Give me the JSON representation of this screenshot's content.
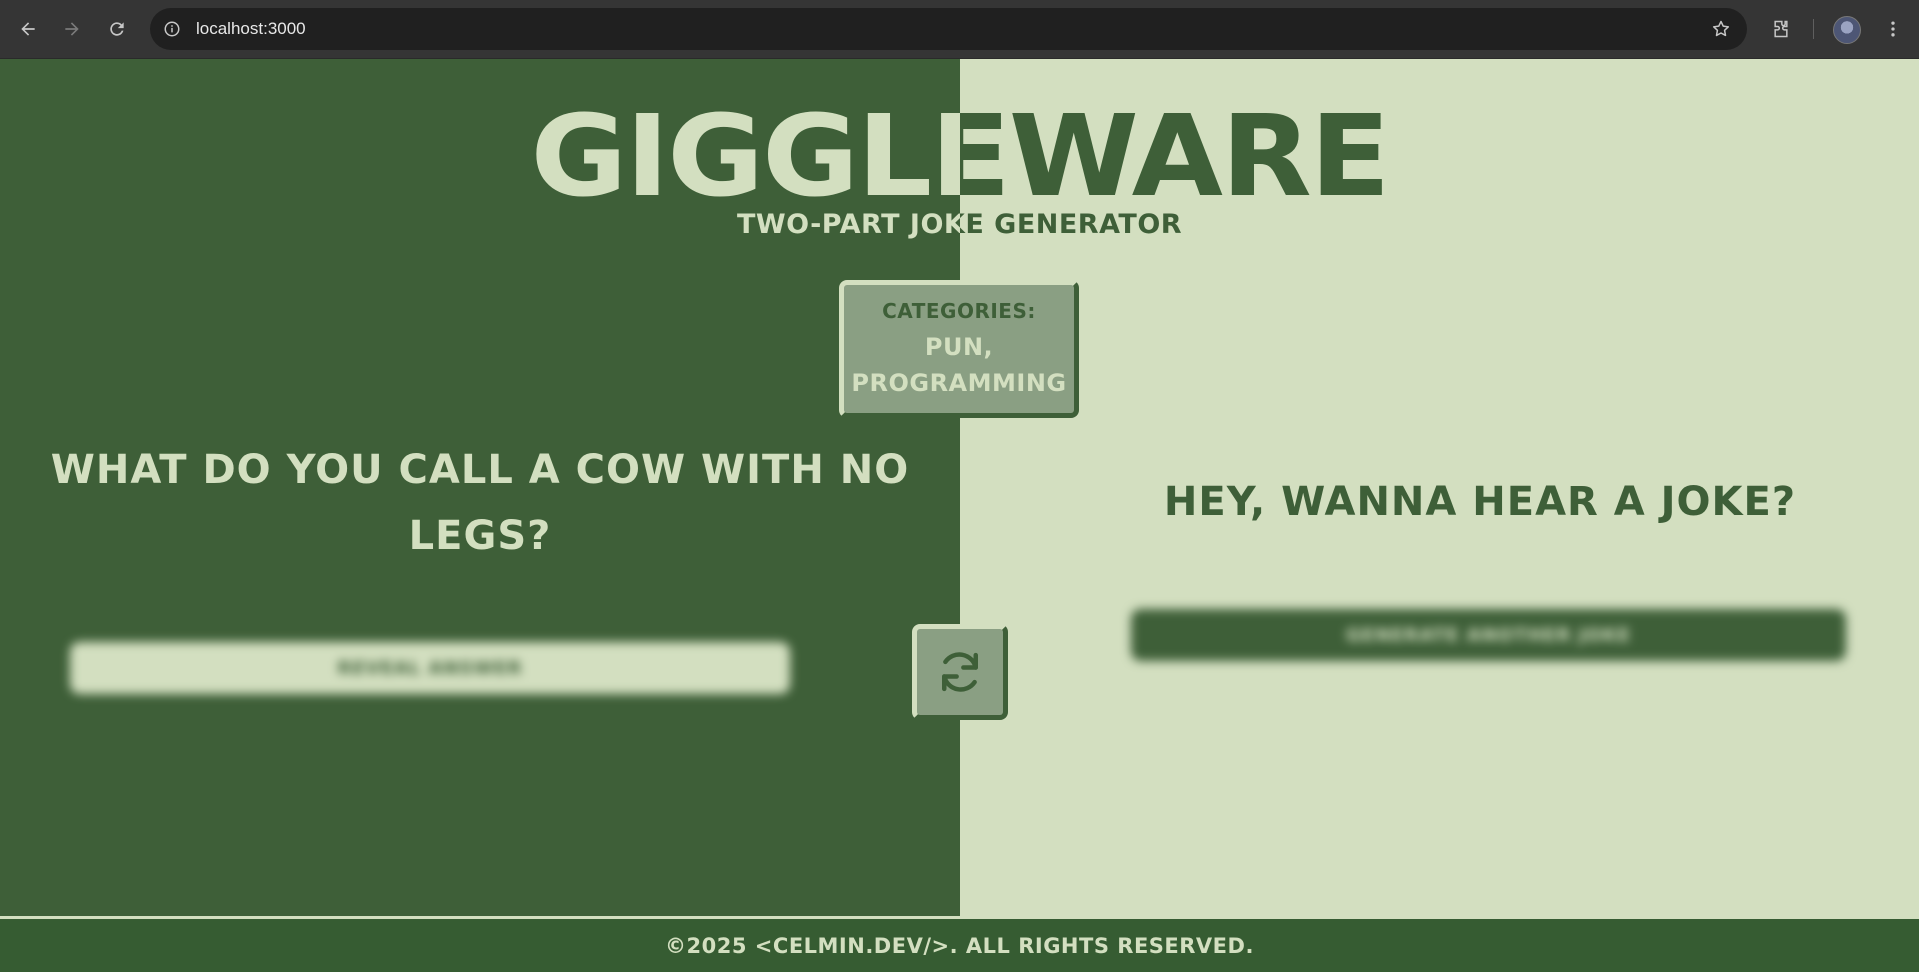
{
  "browser": {
    "url": "localhost:3000"
  },
  "header": {
    "logo": "GIGGLEWARE",
    "subtitle": "TWO-PART JOKE GENERATOR"
  },
  "categories": {
    "label": "CATEGORIES:",
    "values_line1": "PUN,",
    "values_line2": "PROGRAMMING"
  },
  "joke": {
    "question": "WHAT DO YOU CALL A COW WITH NO LEGS?",
    "setup_prompt": "HEY, WANNA HEAR A JOKE?"
  },
  "buttons": {
    "reveal_label": "REVEAL ANSWER",
    "another_label": "GENERATE ANOTHER JOKE"
  },
  "footer": {
    "text": "©2025 <CELMIN.DEV/>. ALL RIGHTS RESERVED."
  },
  "colors": {
    "dark_green": "#3e5f38",
    "light_green": "#d3dfc0",
    "mid_green": "#8a9f83",
    "footer_green": "#365c32"
  }
}
